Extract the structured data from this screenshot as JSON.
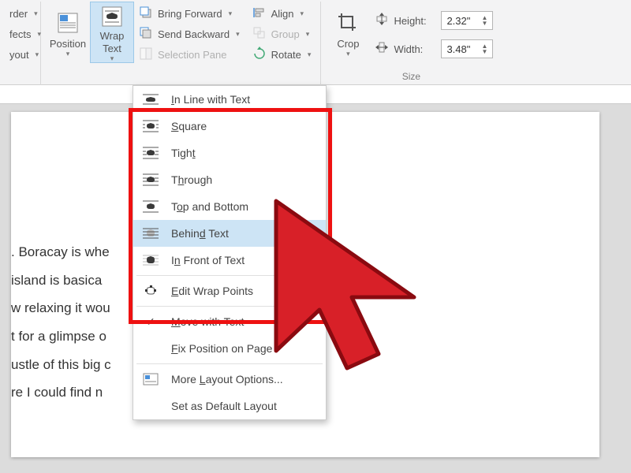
{
  "ribbon": {
    "left_partial": {
      "border": "rder",
      "effects": "fects",
      "layout": "yout"
    },
    "position": {
      "label": "Position"
    },
    "wrap": {
      "label": "Wrap\nText"
    },
    "arrange": {
      "forward": "Bring Forward",
      "backward": "Send Backward",
      "selpane": "Selection Pane",
      "align": "Align",
      "group": "Group",
      "rotate": "Rotate"
    },
    "crop": {
      "label": "Crop"
    },
    "size": {
      "height_label": "Height:",
      "width_label": "Width:",
      "height": "2.32\"",
      "width": "3.48\"",
      "group_label": "Size"
    }
  },
  "menu": {
    "inline": "In Line with Text",
    "square": "Square",
    "tight": "Tight",
    "through": "Through",
    "topbottom": "Top and Bottom",
    "behind": "Behind Text",
    "front": "In Front of Text",
    "editpoints": "Edit Wrap Points",
    "movewith": "Move with Text",
    "fixpos": "Fix Position on Page",
    "morelayout": "More Layout Options...",
    "setdefault": "Set as Default Layout"
  },
  "doc": {
    "l1": ".  Boracay is whe",
    "l2": " island is basica",
    "l3": "w relaxing it wou",
    "l4": "t for a glimpse o",
    "l5": "ustle of this big c",
    "l6": "re I could find n"
  }
}
